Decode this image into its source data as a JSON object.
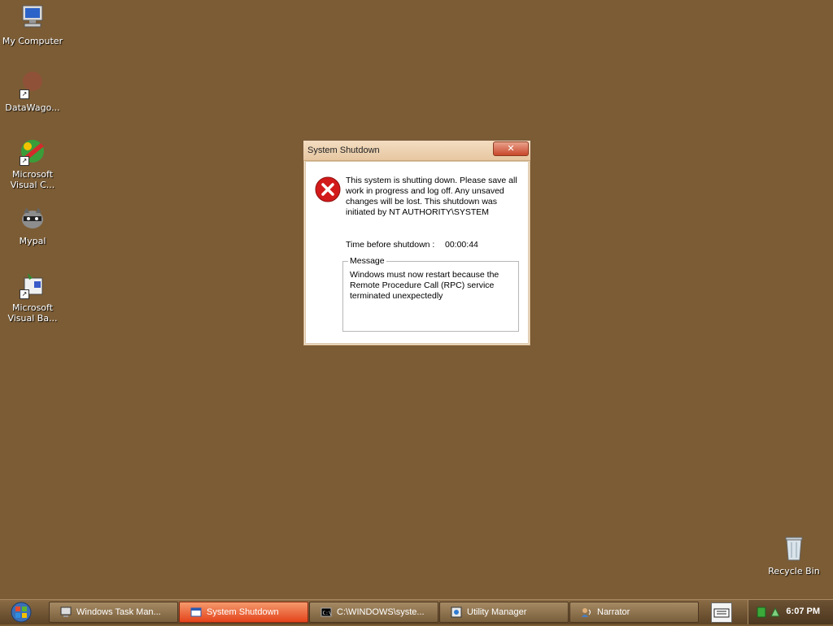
{
  "desktop": {
    "icons": [
      {
        "label": "My Computer"
      },
      {
        "label": "DataWago..."
      },
      {
        "label": "Microsoft Visual C..."
      },
      {
        "label": "Mypal"
      },
      {
        "label": "Microsoft Visual Ba..."
      },
      {
        "label": "Recycle Bin"
      }
    ]
  },
  "dialog": {
    "title": "System Shutdown",
    "close_label": "✕",
    "warning": "This system is shutting down. Please save all work in progress and log off. Any unsaved changes will be lost. This shutdown was initiated by NT AUTHORITY\\SYSTEM",
    "time_label": "Time before shutdown :",
    "time_value": "00:00:44",
    "message_legend": "Message",
    "message_text": "Windows must now restart because the Remote Procedure Call (RPC) service terminated unexpectedly"
  },
  "taskbar": {
    "tasks": [
      {
        "label": "Windows Task Man..."
      },
      {
        "label": "System Shutdown"
      },
      {
        "label": "C:\\WINDOWS\\syste..."
      },
      {
        "label": "Utility Manager"
      },
      {
        "label": "Narrator"
      }
    ],
    "clock": "6:07 PM"
  }
}
